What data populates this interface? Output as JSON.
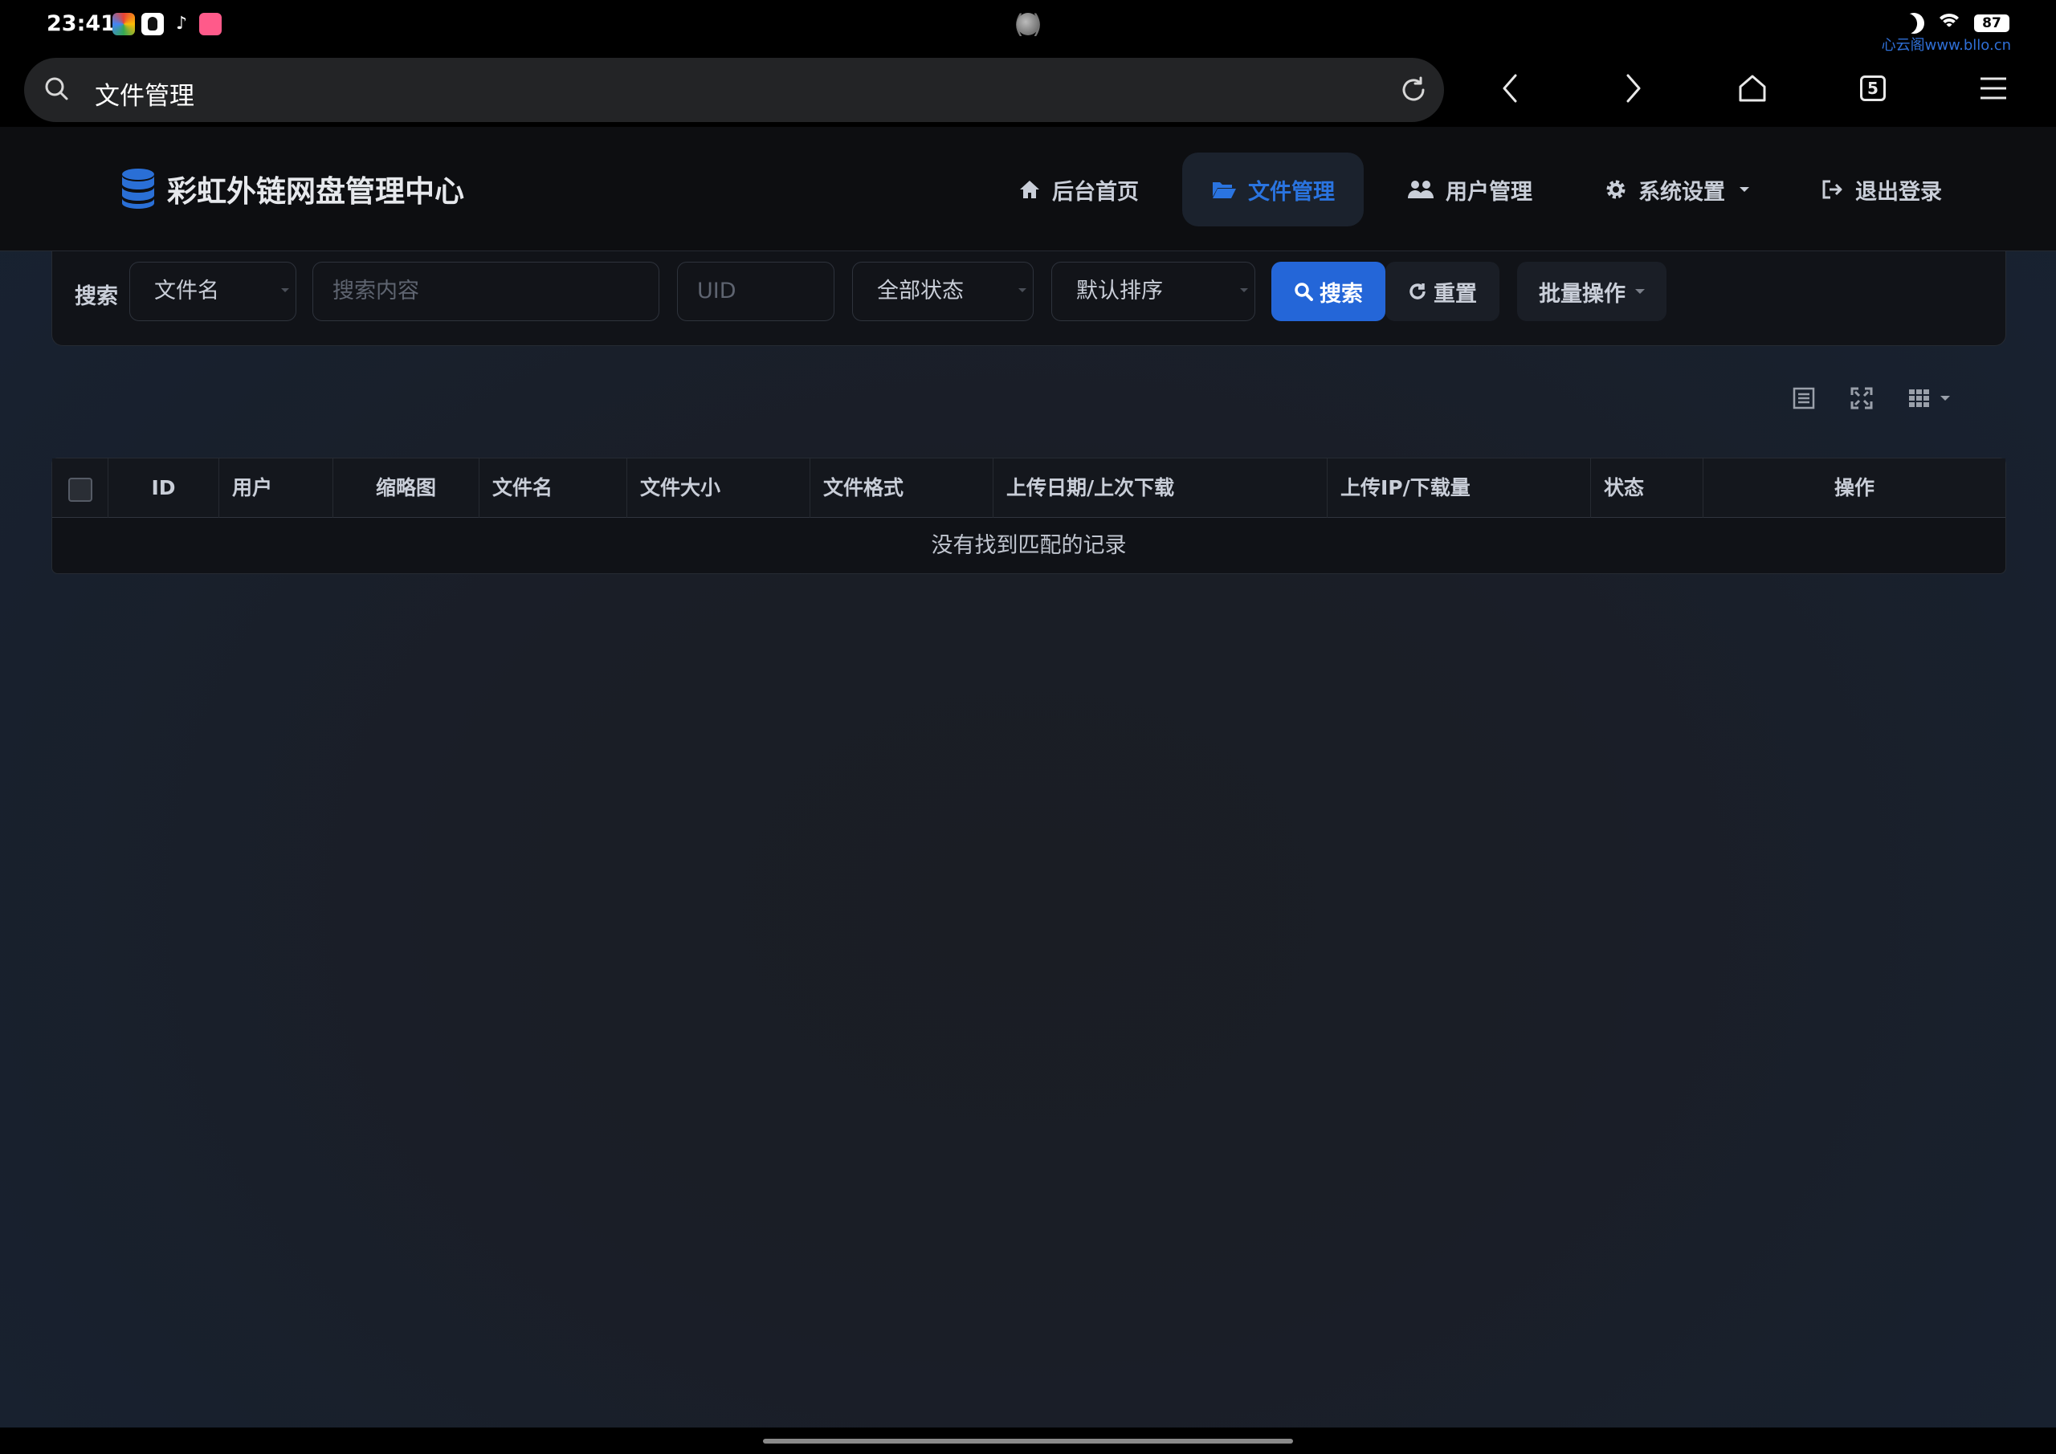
{
  "status_bar": {
    "time": "23:41",
    "battery": "87",
    "watermark": "心云阁www.bllo.cn",
    "icons": [
      "app-icon",
      "qq-icon",
      "tiktok-icon",
      "app-pink-icon",
      "moon-icon",
      "wifi-icon",
      "battery-icon"
    ]
  },
  "browser": {
    "url_text": "文件管理",
    "tab_count": "5",
    "icons": [
      "search-icon",
      "reload-icon",
      "back-icon",
      "forward-icon",
      "home-icon",
      "tabs-icon",
      "menu-icon"
    ]
  },
  "navbar": {
    "brand": "彩虹外链网盘管理中心",
    "items": [
      {
        "label": "后台首页",
        "icon": "home-icon",
        "active": false
      },
      {
        "label": "文件管理",
        "icon": "folder-open-icon",
        "active": true
      },
      {
        "label": "用户管理",
        "icon": "users-icon",
        "active": false
      },
      {
        "label": "系统设置",
        "icon": "gear-icon",
        "active": false,
        "dropdown": true
      },
      {
        "label": "退出登录",
        "icon": "sign-out-icon",
        "active": false
      }
    ]
  },
  "search": {
    "label": "搜索",
    "type_select": "文件名",
    "content_placeholder": "搜索内容",
    "uid_placeholder": "UID",
    "status_select": "全部状态",
    "sort_select": "默认排序",
    "search_button": "搜索",
    "reset_button": "重置",
    "batch_button": "批量操作"
  },
  "table": {
    "columns": [
      "ID",
      "用户",
      "缩略图",
      "文件名",
      "文件大小",
      "文件格式",
      "上传日期/上次下载",
      "上传IP/下载量",
      "状态",
      "操作"
    ],
    "empty_text": "没有找到匹配的记录",
    "toolbar_icons": [
      "list-icon",
      "fullscreen-icon",
      "columns-grid-icon"
    ]
  },
  "colors": {
    "accent": "#2466d8",
    "active_nav_text": "#2a74e0",
    "navbar_bg": "#0d0e11",
    "page_bg": "#1a1e27"
  }
}
